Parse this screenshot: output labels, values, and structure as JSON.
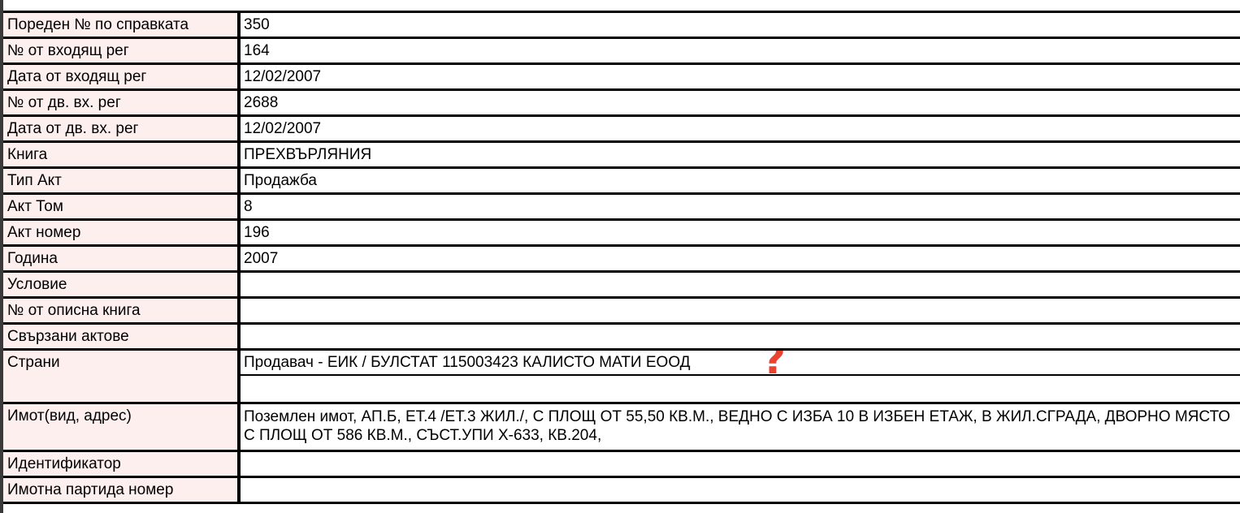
{
  "rows": [
    {
      "label": "Пореден № по справката",
      "value": "350"
    },
    {
      "label": "№ от входящ рег",
      "value": "164"
    },
    {
      "label": "Дата от входящ рег",
      "value": "12/02/2007"
    },
    {
      "label": "№ от дв. вх. рег",
      "value": "2688"
    },
    {
      "label": "Дата от дв. вх. рег",
      "value": "12/02/2007"
    },
    {
      "label": "Книга",
      "value": "ПРЕХВЪРЛЯНИЯ"
    },
    {
      "label": "Тип Акт",
      "value": "Продажба"
    },
    {
      "label": "Акт Том",
      "value": "8"
    },
    {
      "label": "Акт номер",
      "value": "196"
    },
    {
      "label": "Година",
      "value": "2007"
    },
    {
      "label": "Условие",
      "value": ""
    },
    {
      "label": "№ от описна книга",
      "value": ""
    },
    {
      "label": "Свързани актове",
      "value": ""
    },
    {
      "label": "Страни",
      "value": "Продавач - ЕИК / БУЛСТАТ 115003423 КАЛИСТО МАТИ ЕООД",
      "value2": ""
    },
    {
      "label": "Имот(вид, адрес)",
      "value": "Поземлен имот, АП.Б, ЕТ.4 /ЕТ.3 ЖИЛ./, С ПЛОЩ ОТ 55,50 КВ.М., ВЕДНО С ИЗБА 10 В ИЗБЕН ЕТАЖ, В ЖИЛ.СГРАДА, ДВОРНО МЯСТО С ПЛОЩ ОТ 586 КВ.М., СЪСТ.УПИ Х-633, КВ.204,"
    },
    {
      "label": "Идентификатор",
      "value": ""
    },
    {
      "label": "Имотна партида номер",
      "value": ""
    }
  ],
  "icons": {
    "help": {
      "name": "question-mark-icon",
      "glyph": "?",
      "color": "#e8442f"
    }
  },
  "colors": {
    "label_background": "#fcefee",
    "border": "#000000"
  }
}
